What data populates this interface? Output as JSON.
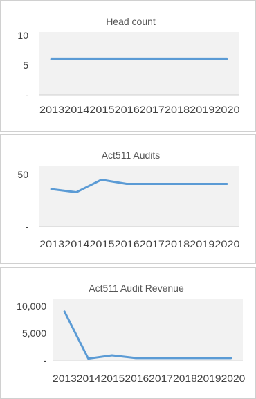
{
  "chart_data": [
    {
      "type": "line",
      "title": "Head count",
      "categories": [
        "2013",
        "2014",
        "2015",
        "2016",
        "2017",
        "2018",
        "2019",
        "2020"
      ],
      "series": [
        {
          "values": [
            6,
            6,
            6,
            6,
            6,
            6,
            6,
            6
          ]
        }
      ],
      "ylim": [
        0,
        10
      ],
      "yticks": [
        0,
        5,
        10
      ],
      "ytick_labels": [
        "-",
        "5",
        "10"
      ],
      "grid": false,
      "color": "#5b9bd5"
    },
    {
      "type": "line",
      "title": "Act511 Audits",
      "categories": [
        "2013",
        "2014",
        "2015",
        "2016",
        "2017",
        "2018",
        "2019",
        "2020"
      ],
      "series": [
        {
          "values": [
            36,
            33,
            45,
            41,
            41,
            41,
            41,
            41
          ]
        }
      ],
      "ylim": [
        0,
        50
      ],
      "yticks": [
        0,
        50
      ],
      "ytick_labels": [
        "-",
        "50"
      ],
      "grid": false,
      "color": "#5b9bd5"
    },
    {
      "type": "line",
      "title": "Act511 Audit Revenue",
      "categories": [
        "2013",
        "2014",
        "2015",
        "2016",
        "2017",
        "2018",
        "2019",
        "2020"
      ],
      "series": [
        {
          "values": [
            9000,
            300,
            900,
            400,
            400,
            400,
            400,
            400
          ]
        }
      ],
      "ylim": [
        0,
        10000
      ],
      "yticks": [
        0,
        5000,
        10000
      ],
      "ytick_labels": [
        "-",
        "5,000",
        "10,000"
      ],
      "grid": false,
      "color": "#5b9bd5"
    }
  ]
}
